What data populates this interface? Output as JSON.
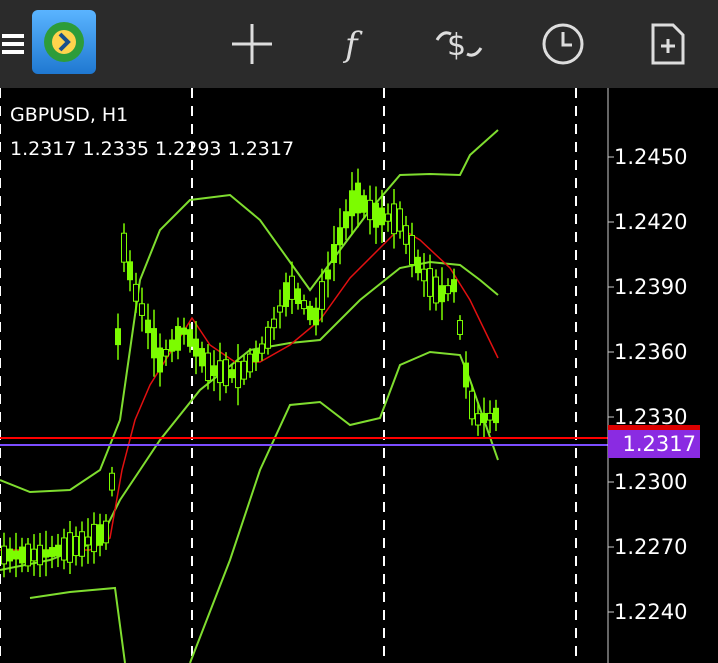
{
  "toolbar": {
    "icons": [
      "menu-icon",
      "app-logo",
      "crosshair-icon",
      "function-icon",
      "trade-icon",
      "clock-icon",
      "new-document-icon"
    ]
  },
  "chart": {
    "symbol": "GBPUSD, H1",
    "ohlc": "1.2317 1.2335 1.2293 1.2317",
    "price_levels": [
      "1.2450",
      "1.2420",
      "1.2390",
      "1.2360",
      "1.2330",
      "1.2300",
      "1.2270",
      "1.2240"
    ],
    "current_price": "1.2317",
    "colors": {
      "candles": "#7cfc00",
      "bands": "#7fdd2f",
      "ma": "#e11010",
      "bid_line": "#ff0000",
      "ask_line": "#7b4dff",
      "grid": "#cccccc"
    }
  }
}
